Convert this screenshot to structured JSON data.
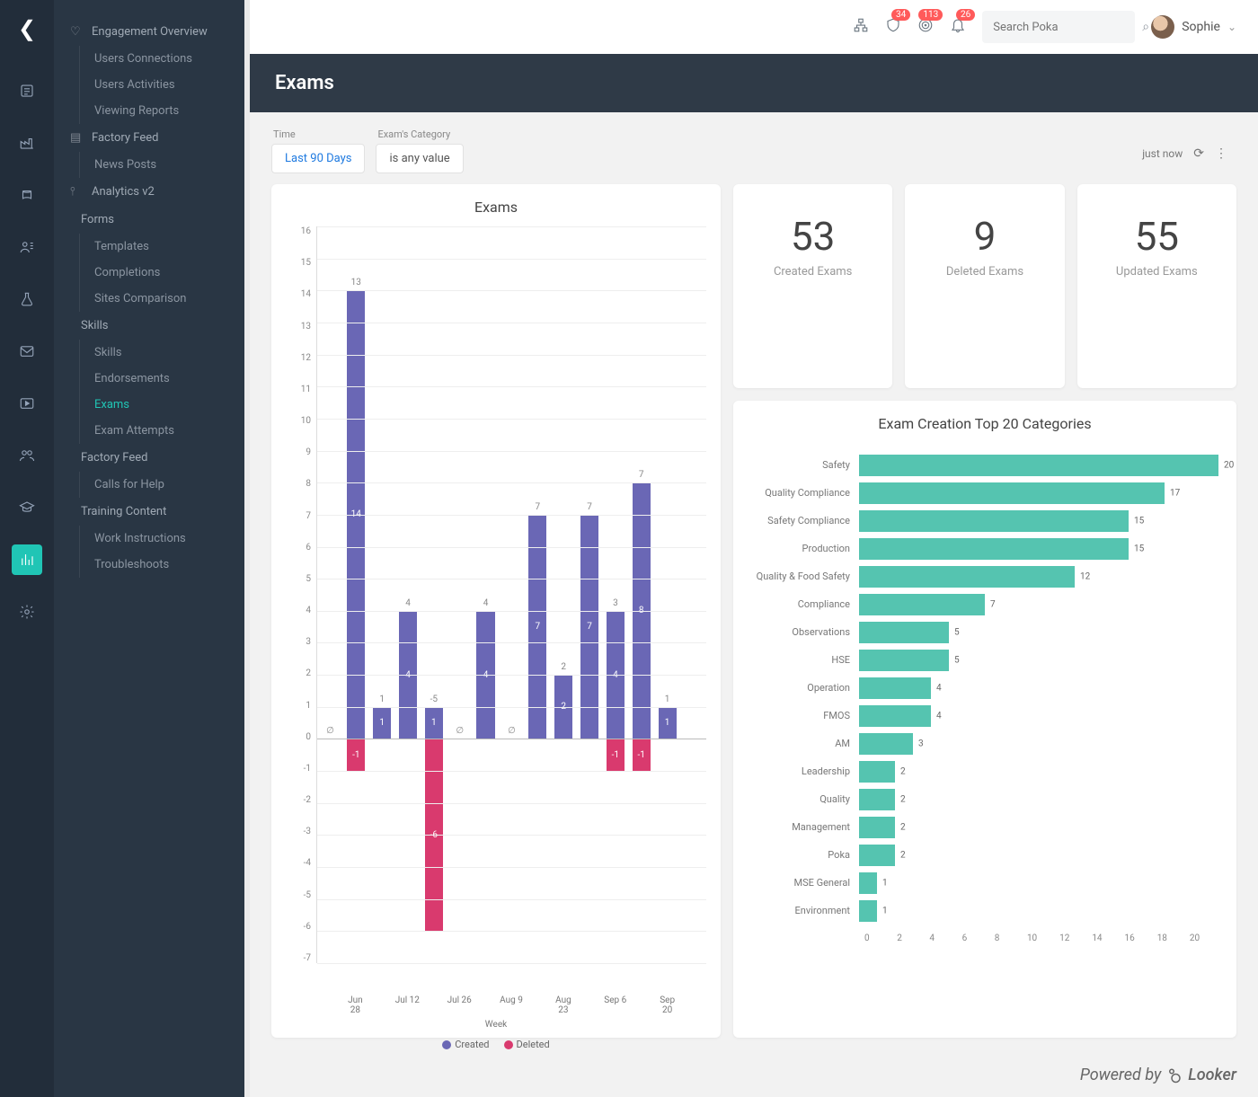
{
  "topbar": {
    "badges": {
      "shield": "34",
      "radar": "113",
      "bell": "26"
    },
    "search_placeholder": "Search Poka",
    "user_name": "Sophie"
  },
  "sidebar": {
    "sections": [
      {
        "icon": "heart",
        "label": "Engagement Overview",
        "children": [
          {
            "label": "Users Connections"
          },
          {
            "label": "Users Activities"
          },
          {
            "label": "Viewing Reports"
          }
        ]
      },
      {
        "icon": "feed",
        "label": "Factory Feed",
        "children": [
          {
            "label": "News Posts"
          }
        ]
      },
      {
        "icon": "chart",
        "label": "Analytics v2",
        "groups": [
          {
            "label": "Forms",
            "children": [
              {
                "label": "Templates"
              },
              {
                "label": "Completions"
              },
              {
                "label": "Sites Comparison"
              }
            ]
          },
          {
            "label": "Skills",
            "children": [
              {
                "label": "Skills"
              },
              {
                "label": "Endorsements"
              },
              {
                "label": "Exams",
                "active": true
              },
              {
                "label": "Exam Attempts"
              }
            ]
          },
          {
            "label": "Factory Feed",
            "children": [
              {
                "label": "Calls for Help"
              }
            ]
          },
          {
            "label": "Training Content",
            "children": [
              {
                "label": "Work Instructions"
              },
              {
                "label": "Troubleshoots"
              }
            ]
          }
        ]
      }
    ]
  },
  "page": {
    "title": "Exams",
    "filters": {
      "time_label": "Time",
      "time_value": "Last 90 Days",
      "category_label": "Exam's Category",
      "category_value": "is any value"
    },
    "refresh": {
      "text": "just now"
    }
  },
  "stats": {
    "created": {
      "value": "53",
      "label": "Created Exams"
    },
    "deleted": {
      "value": "9",
      "label": "Deleted Exams"
    },
    "updated": {
      "value": "55",
      "label": "Updated Exams"
    }
  },
  "chart_data": [
    {
      "id": "exams_over_time",
      "type": "bar",
      "title": "Exams",
      "xlabel": "Week",
      "ylim": [
        -7,
        16
      ],
      "legend": [
        "Created",
        "Deleted"
      ],
      "categories": [
        "",
        "Jun 28",
        "",
        "Jul 12",
        "",
        "Jul 26",
        "",
        "Aug 9",
        "",
        "Aug 23",
        "",
        "Sep 6",
        "",
        "Sep 20",
        ""
      ],
      "series": [
        {
          "name": "Created",
          "color": "#6a67b5",
          "values": [
            0,
            14,
            1,
            4,
            1,
            0,
            4,
            0,
            7,
            2,
            7,
            4,
            8,
            1,
            0
          ]
        },
        {
          "name": "Deleted",
          "color": "#d93a6e",
          "values": [
            0,
            -1,
            0,
            0,
            -6,
            0,
            0,
            0,
            0,
            0,
            0,
            -1,
            -1,
            0,
            0
          ]
        }
      ],
      "totals": [
        "∅",
        "13",
        "1",
        "4",
        "-5",
        "∅",
        "4",
        "∅",
        "7",
        "2",
        "7",
        "3",
        "7",
        "1",
        ""
      ]
    },
    {
      "id": "top_categories",
      "type": "bar",
      "orientation": "horizontal",
      "title": "Exam Creation Top 20 Categories",
      "xlim": [
        0,
        20
      ],
      "xticks": [
        0,
        2,
        4,
        6,
        8,
        10,
        12,
        14,
        16,
        18,
        20
      ],
      "categories": [
        "Safety",
        "Quality Compliance",
        "Safety Compliance",
        "Production",
        "Quality & Food Safety",
        "Compliance",
        "Observations",
        "HSE",
        "Operation",
        "FMOS",
        "AM",
        "Leadership",
        "Quality",
        "Management",
        "Poka",
        "MSE General",
        "Environment"
      ],
      "values": [
        20,
        17,
        15,
        15,
        12,
        7,
        5,
        5,
        4,
        4,
        3,
        2,
        2,
        2,
        2,
        1,
        1
      ]
    }
  ]
}
